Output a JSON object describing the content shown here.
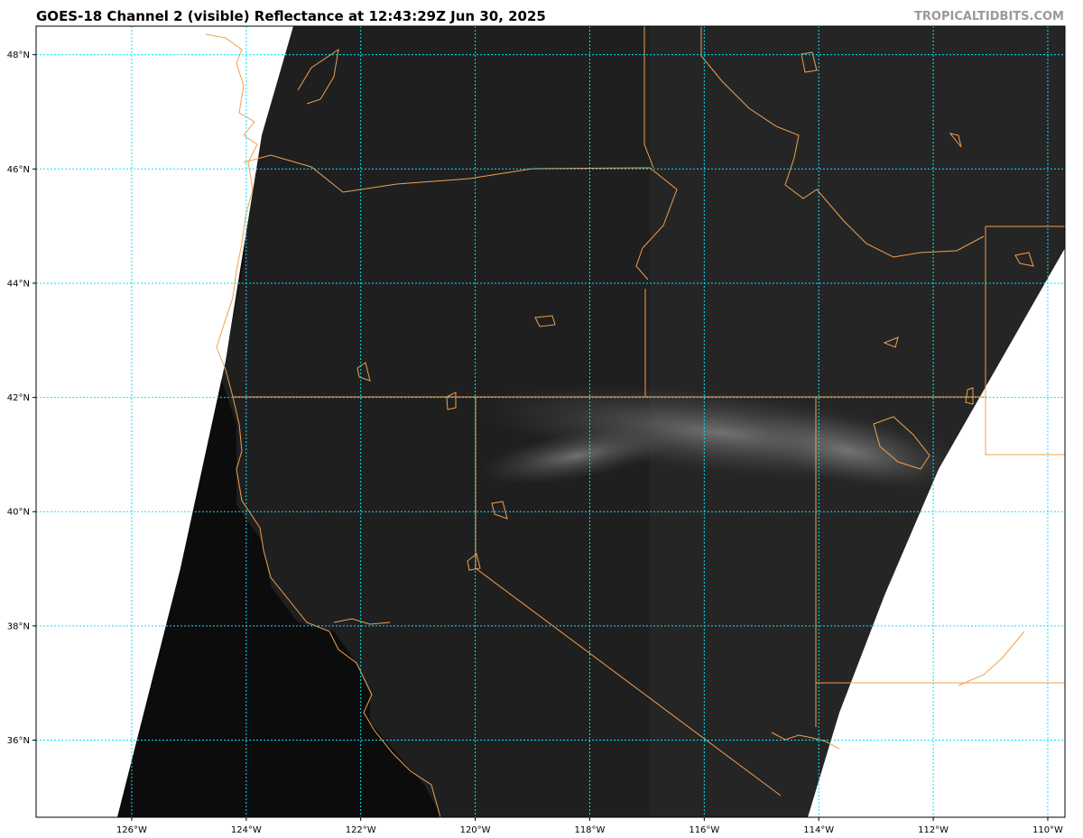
{
  "header": {
    "title": "GOES-18 Channel 2 (visible) Reflectance at 12:43:29Z Jun 30, 2025",
    "credit": "TROPICALTIDBITS.COM"
  },
  "map": {
    "projection": "geostationary satellite visible imagery",
    "lon_range": [
      -127.67,
      -109.7
    ],
    "lat_range": [
      34.65,
      48.5
    ],
    "colors": {
      "background": "#ffffff",
      "land": "#222222",
      "ocean": "#0c0c0c",
      "gridlines": "#00e5ff",
      "borders": "#f0a050"
    },
    "longitudes": [
      {
        "value": -126,
        "label": "126°W"
      },
      {
        "value": -124,
        "label": "124°W"
      },
      {
        "value": -122,
        "label": "122°W"
      },
      {
        "value": -120,
        "label": "120°W"
      },
      {
        "value": -118,
        "label": "118°W"
      },
      {
        "value": -116,
        "label": "116°W"
      },
      {
        "value": -114,
        "label": "114°W"
      },
      {
        "value": -112,
        "label": "112°W"
      },
      {
        "value": -110,
        "label": "110°W"
      }
    ],
    "latitudes": [
      {
        "value": 48,
        "label": "48°N"
      },
      {
        "value": 46,
        "label": "46°N"
      },
      {
        "value": 44,
        "label": "44°N"
      },
      {
        "value": 42,
        "label": "42°N"
      },
      {
        "value": 40,
        "label": "40°N"
      },
      {
        "value": 38,
        "label": "38°N"
      },
      {
        "value": 36,
        "label": "36°N"
      }
    ]
  }
}
